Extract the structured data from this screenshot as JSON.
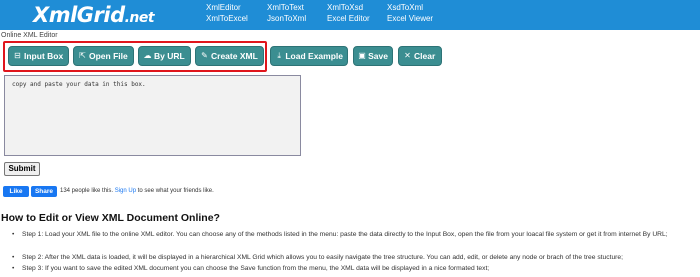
{
  "header": {
    "logo_main": "XmlGrid",
    "logo_suffix": ".net",
    "nav": [
      {
        "label": "XmlEditor"
      },
      {
        "label": "XmlToText"
      },
      {
        "label": "XmlToXsd"
      },
      {
        "label": "XsdToXml"
      },
      {
        "label": "XmlToExcel"
      },
      {
        "label": "JsonToXml"
      },
      {
        "label": "Excel Editor"
      },
      {
        "label": "Excel Viewer"
      }
    ],
    "bg_color": "#1f8dd6"
  },
  "page": {
    "subtitle": "Online XML Editor"
  },
  "toolbar": {
    "button_color": "#3b8e91",
    "highlight_color": "#e0151c",
    "buttons": [
      {
        "label": "Input Box",
        "icon": "input-box-icon",
        "glyph": "⊟"
      },
      {
        "label": "Open File",
        "icon": "open-file-icon",
        "glyph": "⇱"
      },
      {
        "label": "By URL",
        "icon": "cloud-icon",
        "glyph": "☁"
      },
      {
        "label": "Create XML",
        "icon": "pencil-icon",
        "glyph": "✎"
      },
      {
        "label": "Load Example",
        "icon": "download-icon",
        "glyph": "⤓"
      },
      {
        "label": "Save",
        "icon": "save-icon",
        "glyph": "▣"
      },
      {
        "label": "Clear",
        "icon": "close-icon",
        "glyph": "✕"
      }
    ]
  },
  "editor": {
    "placeholder": "copy and paste your data in this box."
  },
  "form": {
    "submit_label": "Submit"
  },
  "facebook": {
    "like_label": "Like",
    "share_label": "Share",
    "count_text": "134 people like this.",
    "signup_text": "Sign Up",
    "signup_suffix": "to see what your friends like."
  },
  "howto": {
    "title": "How to Edit or View XML Document Online?",
    "steps": [
      {
        "text": "Step 1: Load your XML file to the online XML editor. You can choose any of the methods listed in the menu: paste the data directly to the Input Box, open the file from your loacal file system or get it from internet By URL;"
      },
      {
        "text": "Step 2: After the XML data is loaded, it will be displayed in a hierarchical XML Grid which allows you to easily navigate the tree structure. You can add, edit, or delete any node or brach of the tree stucture;"
      },
      {
        "text": "Step 3: If you want to save the edited XML document you can choose the Save function from the menu, the XML data will be displayed in a nice formated text;"
      }
    ]
  }
}
